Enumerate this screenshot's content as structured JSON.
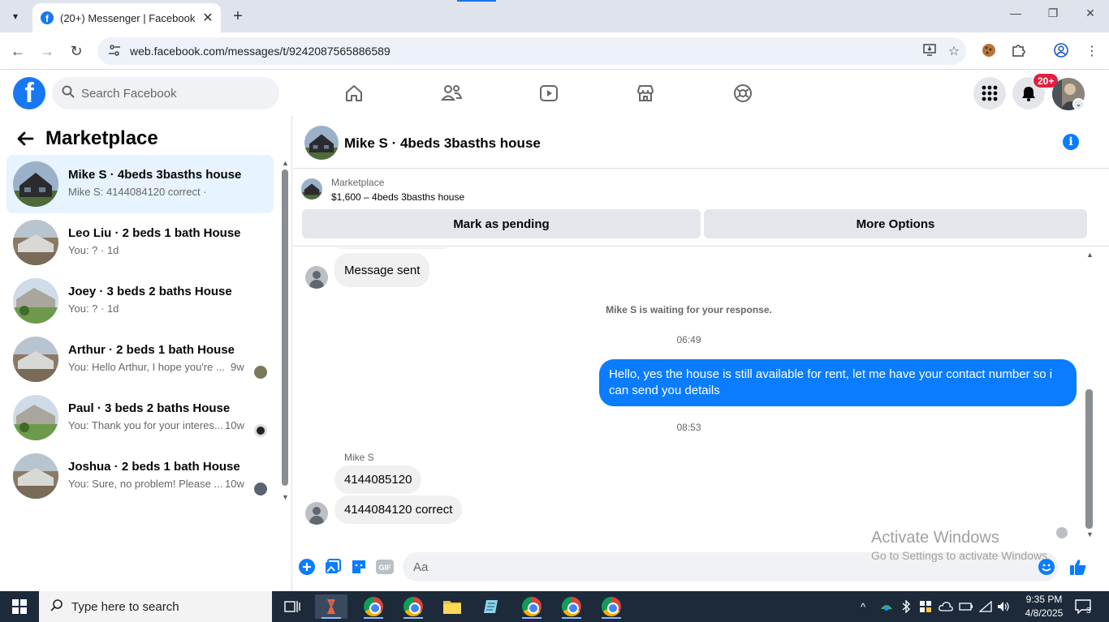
{
  "browser": {
    "tab_title": "(20+) Messenger | Facebook",
    "url": "web.facebook.com/messages/t/9242087565886589"
  },
  "fb": {
    "search_placeholder": "Search Facebook",
    "notification_badge": "20+"
  },
  "left": {
    "title": "Marketplace",
    "conversations": [
      {
        "name": "Mike S · 4beds 3basths house",
        "snippet": "Mike S: 4144084120 correct ·",
        "time": "",
        "active": true
      },
      {
        "name": "Leo Liu · 2 beds 1 bath House",
        "snippet": "You: ? · 1d",
        "time": ""
      },
      {
        "name": "Joey · 3 beds 2 baths House",
        "snippet": "You: ? · 1d",
        "time": ""
      },
      {
        "name": "Arthur · 2 beds 1 bath House",
        "snippet": "You: Hello Arthur, I hope you're ...",
        "time": "9w"
      },
      {
        "name": "Paul · 3 beds 2 baths House",
        "snippet": "You: Thank you for your interes...",
        "time": "10w"
      },
      {
        "name": "Joshua · 2 beds 1 bath House",
        "snippet": "You: Sure, no problem! Please ...",
        "time": "10w"
      }
    ]
  },
  "chat": {
    "title": "Mike S · 4beds 3basths house",
    "marketplace_label": "Marketplace",
    "listing": "$1,600 – 4beds 3basths house",
    "btn_pending": "Mark as pending",
    "btn_more": "More Options",
    "messages": {
      "sent_status": "Message sent",
      "waiting": "Mike S is waiting for your response.",
      "time1": "06:49",
      "outgoing": "Hello, yes the house is still available for rent, let me have your contact number so i can send you  details",
      "time2": "08:53",
      "sender": "Mike S",
      "in1": "4144085120",
      "in2": "4144084120 correct"
    },
    "composer_placeholder": "Aa"
  },
  "watermark": {
    "line1": "Activate Windows",
    "line2": "Go to Settings to activate Windows."
  },
  "taskbar": {
    "search_placeholder": "Type here to search",
    "time": "9:35 PM",
    "date": "4/8/2025",
    "notif_count": "3"
  },
  "colors": {
    "fb_blue": "#1877f2",
    "messenger_blue": "#0a7cff",
    "active_row": "#e7f3ff",
    "badge_red": "#e41e3f"
  }
}
